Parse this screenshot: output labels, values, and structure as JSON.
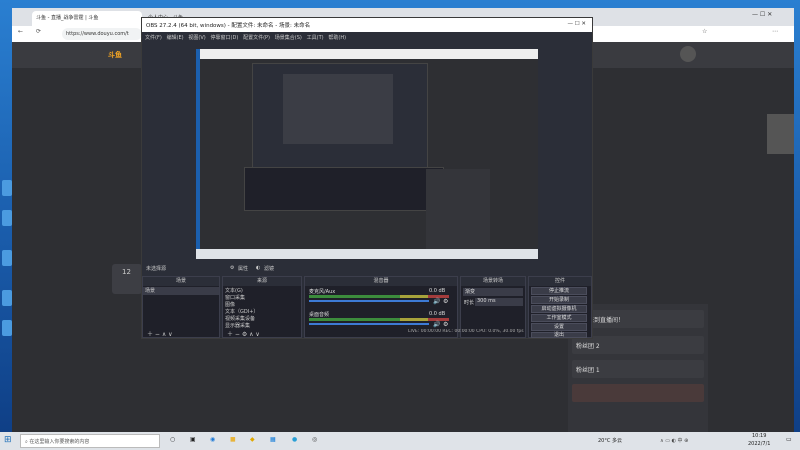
{
  "browser": {
    "tabs": [
      {
        "label": "斗鱼 - 直播_战争雷霆 | 斗鱼"
      },
      {
        "label": "个人中心 - 斗鱼"
      }
    ],
    "url": "https://www.douyu.com/t"
  },
  "obs": {
    "title": "OBS 27.2.4 (64 bit, windows) - 配置文件: 未命名 - 场景: 未命名",
    "menu": [
      "文件(F)",
      "编辑(E)",
      "视图(V)",
      "停靠窗口(D)",
      "配置文件(P)",
      "场景集合(S)",
      "工具(T)",
      "帮助(H)"
    ],
    "source_bar": {
      "label": "未选择源",
      "props": "属性",
      "filters": "滤镜"
    },
    "panels": {
      "scenes": {
        "title": "场景",
        "items": [
          "场景"
        ]
      },
      "sources": {
        "title": "来源",
        "items": [
          "文本(G)",
          "窗口采集",
          "图像",
          "文本（GDI+）",
          "视频采集设备",
          "显示器采集"
        ]
      },
      "mixer": {
        "title": "混音器",
        "channels": [
          {
            "name": "麦克风/Aux",
            "level": "0.0 dB"
          },
          {
            "name": "桌面音频",
            "level": "0.0 dB"
          }
        ]
      },
      "transitions": {
        "title": "场景转场",
        "fade": "渐变",
        "duration_label": "时长",
        "duration": "300 ms"
      },
      "controls": {
        "title": "控件",
        "buttons": [
          "停止推流",
          "开始录制",
          "启动虚拟摄像机",
          "工作室模式",
          "设置",
          "退出"
        ]
      }
    },
    "status": {
      "live_label": "LIVE:",
      "live_time": "00:00:00",
      "rec_label": "REC:",
      "rec_time": "00:00:00",
      "cpu": "CPU: 0.0%, 30.00 fps"
    }
  },
  "site": {
    "chat": [
      "欢迎来到直播间！",
      "粉丝团 2",
      "粉丝团 1"
    ]
  },
  "taskbar": {
    "search_placeholder": "在这里输入你要搜索的内容",
    "weather": "20°C 多云",
    "time": "10:19",
    "date": "2022/7/1"
  },
  "colors": {
    "obs_bg": "#2b2e38",
    "desktop": "#1e6fb8",
    "taskbar": "#dfe3e8"
  }
}
